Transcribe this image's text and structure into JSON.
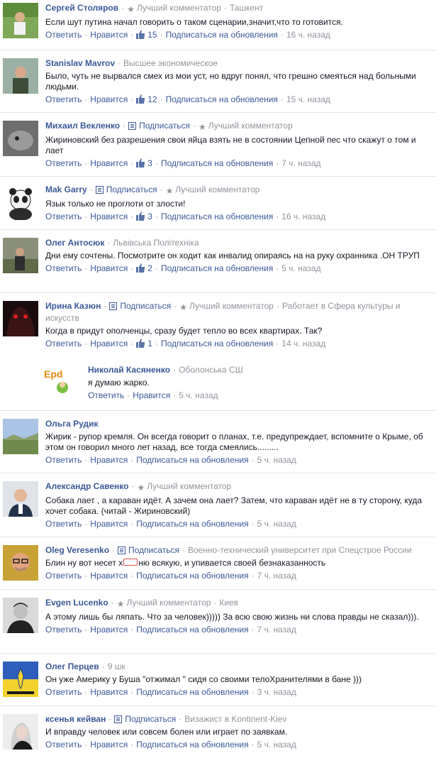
{
  "labels": {
    "reply": "Ответить",
    "like": "Нравится",
    "subscribe": "Подписаться на обновления",
    "follow": "Подписаться"
  },
  "comments": [
    {
      "name": "Сергей Столяров",
      "badge": "Лучший комментатор",
      "meta": "Ташкент",
      "text": "Если шут путина начал говорить о таком сценарии,значит,что то готовится.",
      "likes": "15",
      "time": "16 ч. назад"
    },
    {
      "name": "Stanislav Mavrov",
      "meta": "Высшее экономическое",
      "text": "Было, чуть не вырвался смех из мои уст, но вдруг понял, что грешно смеяться над больными людьми.",
      "likes": "12",
      "time": "15 ч. назад"
    },
    {
      "name": "Михаил Векленко",
      "follow": "Подписаться",
      "badge": "Лучший комментатор",
      "text": "Жириновский без разрешения свои яйца взять не в состоянии Цепной пес что скажут о том и лает",
      "likes": "3",
      "time": "7 ч. назад"
    },
    {
      "name": "Mak Garry",
      "follow": "Подписаться",
      "badge": "Лучший комментатор",
      "text": "Язык только не проглоти от злости!",
      "likes": "3",
      "time": "16 ч. назад"
    },
    {
      "name": "Олег Антосюк",
      "meta": "Львівська Політехніка",
      "text": "Дни ему сочтены. Посмотрите он ходит как инвалид опираясь на на руку охранника .ОН ТРУП",
      "likes": "2",
      "time": "5 ч. назад"
    },
    {
      "name": "Ирина Казюн",
      "follow": "Подписаться",
      "badge": "Лучший комментатор",
      "meta_prefix": "Работает в",
      "meta_link": "Сфера культуры и искусств",
      "text": "Когда в придут ополченцы, сразу будет тепло во всех квартирах. Так?",
      "likes": "1",
      "time": "14 ч. назад"
    },
    {
      "name": "Николай Касяненко",
      "meta": "Оболонська СШ",
      "text": "я думаю жарко.",
      "time": "5 ч. назад",
      "reply": true
    },
    {
      "name": "Ольга Рудик",
      "text": "Жирик - рупор кремля. Он всегда говорит о планах, т.е. предупреждает, вспомните о Крыме, об этом он говорил много лет назад, все тогда смеялись.........",
      "time": "5 ч. назад"
    },
    {
      "name": "Александр Савенко",
      "badge": "Лучший комментатор",
      "text": "Собака лает , а караван идёт. А зачем она лает? Затем, что караван идёт не в ту сторону, куда хочет собака. (читай - Жириновский)",
      "time": "5 ч. назад"
    },
    {
      "name": "Oleg Veresenko",
      "follow": "Подписаться",
      "meta": "Военно-технический университет при Спецстрое России",
      "text_a": "Блин ну вот несет х",
      "text_b": "ню всякую, и упивается своей безнаказанность",
      "time": "7 ч. назад"
    },
    {
      "name": "Evgen Lucenko",
      "badge": "Лучший комментатор",
      "meta": "Киев",
      "text": "А этому лишь бы ляпать. Что за человек))))) За всю свою жизнь ни слова правды не сказал))).",
      "time": "7 ч. назад"
    },
    {
      "name": "Олег Перцев",
      "meta": "9 шк",
      "text": "Он уже Америку у Буша \"отжимал \" сидя со своими телоХранителями в бане )))",
      "time": "3 ч. назад"
    },
    {
      "name": "ксенья кейван",
      "follow": "Подписаться",
      "meta": "Визажист в Kontinent-Kiev",
      "text": "И вправду человек или совсем болен или играет по заявкам.",
      "time": "5 ч. назад"
    }
  ]
}
